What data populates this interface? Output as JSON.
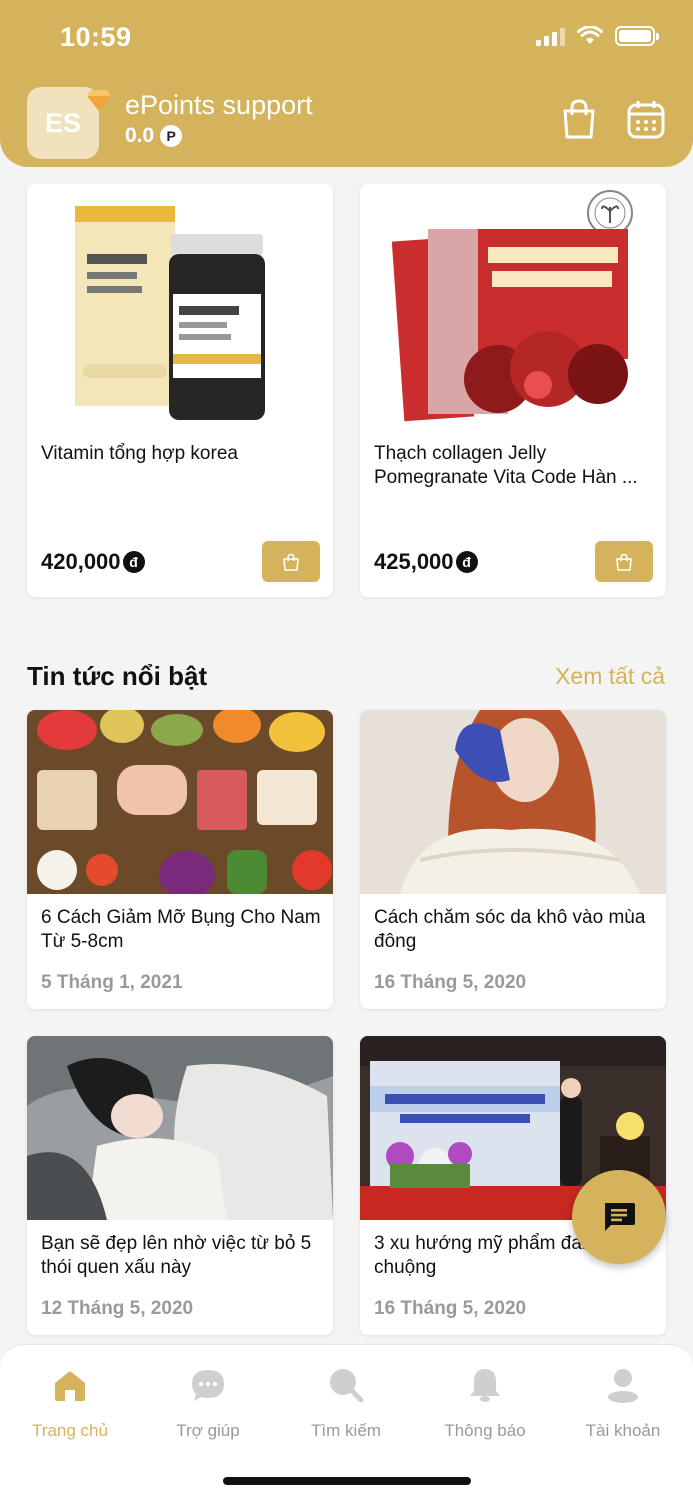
{
  "status": {
    "time": "10:59"
  },
  "header": {
    "avatar_initials": "ES",
    "user_name": "ePoints support",
    "points": "0.0",
    "points_badge": "P",
    "accent": "#d4b35c"
  },
  "products": [
    {
      "name": "Vitamin tổng hợp korea",
      "price": "420,000",
      "currency": "đ"
    },
    {
      "name": "Thạch collagen Jelly Pomegranate Vita Code Hàn ...",
      "price": "425,000",
      "currency": "đ"
    }
  ],
  "news_section": {
    "title": "Tin tức nổi bật",
    "see_all": "Xem tất cả"
  },
  "news": [
    {
      "title": "6 Cách Giảm Mỡ Bụng Cho Nam Từ 5-8cm",
      "date": "5 Tháng 1, 2021"
    },
    {
      "title": "Cách chăm sóc da khô vào mùa đông",
      "date": "16 Tháng 5, 2020"
    },
    {
      "title": "Bạn sẽ đẹp lên nhờ việc từ bỏ 5 thói quen xấu này",
      "date": "12 Tháng 5, 2020"
    },
    {
      "title": "3 xu hướng mỹ phẩm đang ưa chuộng",
      "date": "16 Tháng 5, 2020"
    }
  ],
  "tabs": [
    {
      "label": "Trang chủ",
      "icon": "home-icon",
      "active": true
    },
    {
      "label": "Trợ giúp",
      "icon": "chat-bubble-icon",
      "active": false
    },
    {
      "label": "Tìm kiếm",
      "icon": "search-icon",
      "active": false
    },
    {
      "label": "Thông báo",
      "icon": "bell-icon",
      "active": false
    },
    {
      "label": "Tài khoản",
      "icon": "user-icon",
      "active": false
    }
  ]
}
